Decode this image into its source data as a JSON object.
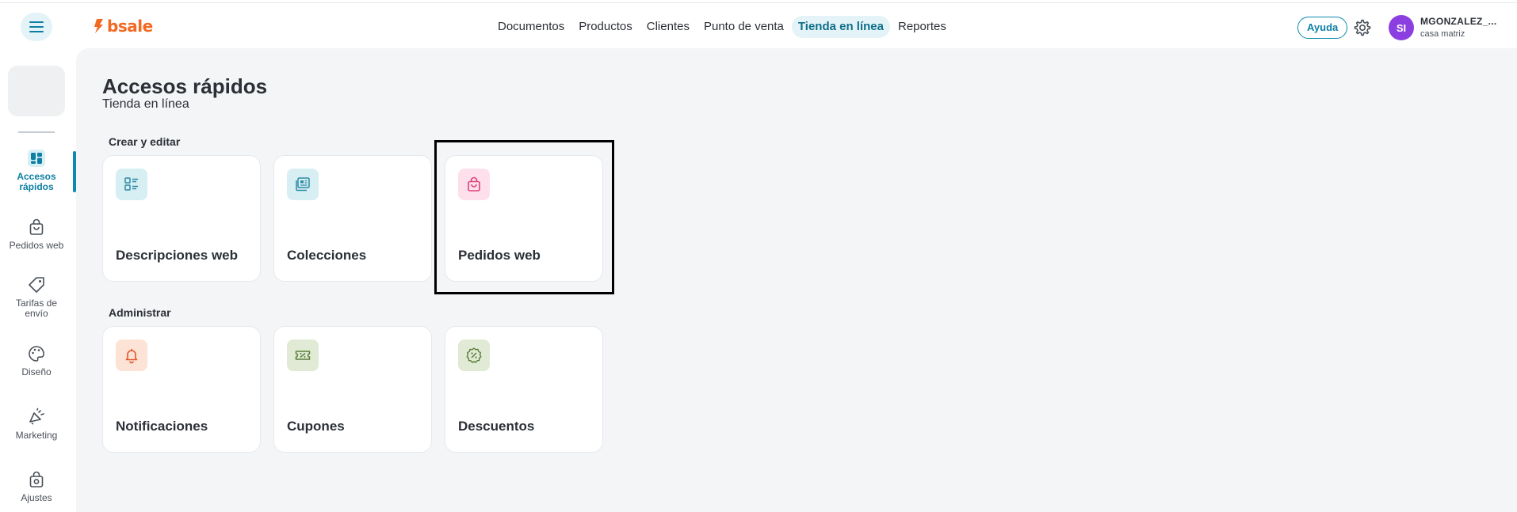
{
  "header": {
    "logo_text": "bsale",
    "nav": [
      {
        "label": "Documentos",
        "active": false
      },
      {
        "label": "Productos",
        "active": false
      },
      {
        "label": "Clientes",
        "active": false
      },
      {
        "label": "Punto de venta",
        "active": false
      },
      {
        "label": "Tienda en línea",
        "active": true
      },
      {
        "label": "Reportes",
        "active": false
      }
    ],
    "help_label": "Ayuda",
    "user": {
      "initials": "SI",
      "name": "MGONZALEZ_...",
      "branch": "casa matriz"
    }
  },
  "sidebar": {
    "items": [
      {
        "label_line1": "Accesos",
        "label_line2": "rápidos",
        "icon": "dashboard-icon",
        "active": true
      },
      {
        "label_line1": "Pedidos web",
        "label_line2": "",
        "icon": "shopping-bag-icon",
        "active": false
      },
      {
        "label_line1": "Tarifas de",
        "label_line2": "envío",
        "icon": "tag-icon",
        "active": false
      },
      {
        "label_line1": "Diseño",
        "label_line2": "",
        "icon": "palette-icon",
        "active": false
      },
      {
        "label_line1": "Marketing",
        "label_line2": "",
        "icon": "megaphone-icon",
        "active": false
      },
      {
        "label_line1": "Ajustes",
        "label_line2": "",
        "icon": "settings-bag-icon",
        "active": false
      }
    ]
  },
  "main": {
    "title": "Accesos rápidos",
    "subtitle": "Tienda en línea",
    "sections": [
      {
        "label": "Crear y editar",
        "cards": [
          {
            "title": "Descripciones web",
            "icon": "description-list-icon",
            "icon_bg": "#d7eef3",
            "icon_color": "#2a8aa3"
          },
          {
            "title": "Colecciones",
            "icon": "collections-icon",
            "icon_bg": "#d7eef3",
            "icon_color": "#2a8aa3"
          },
          {
            "title": "Pedidos web",
            "icon": "shopping-bag-icon",
            "icon_bg": "#fde0ec",
            "icon_color": "#e0407a"
          }
        ]
      },
      {
        "label": "Administrar",
        "cards": [
          {
            "title": "Notificaciones",
            "icon": "bell-icon",
            "icon_bg": "#fde3d6",
            "icon_color": "#e2572a"
          },
          {
            "title": "Cupones",
            "icon": "coupon-icon",
            "icon_bg": "#e0ead5",
            "icon_color": "#5c7f3a"
          },
          {
            "title": "Descuentos",
            "icon": "discount-badge-icon",
            "icon_bg": "#e0ead5",
            "icon_color": "#5c7f3a"
          }
        ]
      }
    ]
  },
  "colors": {
    "brand": "#f26a21",
    "accent": "#0e8ab0",
    "background": "#f4f5f7"
  }
}
